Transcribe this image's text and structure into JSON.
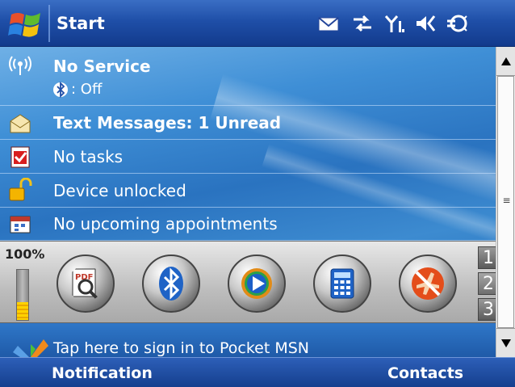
{
  "titlebar": {
    "title": "Start",
    "icons": [
      "windows-flag-icon",
      "message-envelope-icon",
      "connectivity-arrows-icon",
      "signal-antenna-icon",
      "speaker-volume-icon",
      "power-plug-icon"
    ]
  },
  "today": {
    "service": {
      "title": "No Service",
      "bluetooth_status": ": Off",
      "icon": "wireless-broadcast-icon"
    },
    "messages": {
      "label": "Text Messages: 1 Unread",
      "icon": "envelope-icon"
    },
    "tasks": {
      "label": "No tasks",
      "icon": "task-checkbox-icon"
    },
    "lock": {
      "label": "Device unlocked",
      "icon": "padlock-open-icon"
    },
    "calendar": {
      "label": "No upcoming appointments",
      "icon": "calendar-icon"
    }
  },
  "launcher": {
    "battery_label": "100%",
    "battery_level": 1.0,
    "apps": [
      {
        "name": "pdf-viewer",
        "icon": "pdf-magnifier-icon"
      },
      {
        "name": "bluetooth",
        "icon": "bluetooth-icon"
      },
      {
        "name": "media-player",
        "icon": "play-icon"
      },
      {
        "name": "calculator",
        "icon": "calculator-icon"
      },
      {
        "name": "flight-mode",
        "icon": "airplane-off-icon"
      }
    ],
    "pages": [
      "1",
      "2",
      "3"
    ]
  },
  "msn": {
    "text": "Tap here to sign in to Pocket MSN",
    "icon": "msn-butterfly-icon"
  },
  "softkeys": {
    "left": "Notification",
    "right": "Contacts"
  },
  "colors": {
    "titlebar": "#1f4fa8",
    "today_bg": "#2a73c0",
    "softkey_bar": "#153f8e"
  }
}
